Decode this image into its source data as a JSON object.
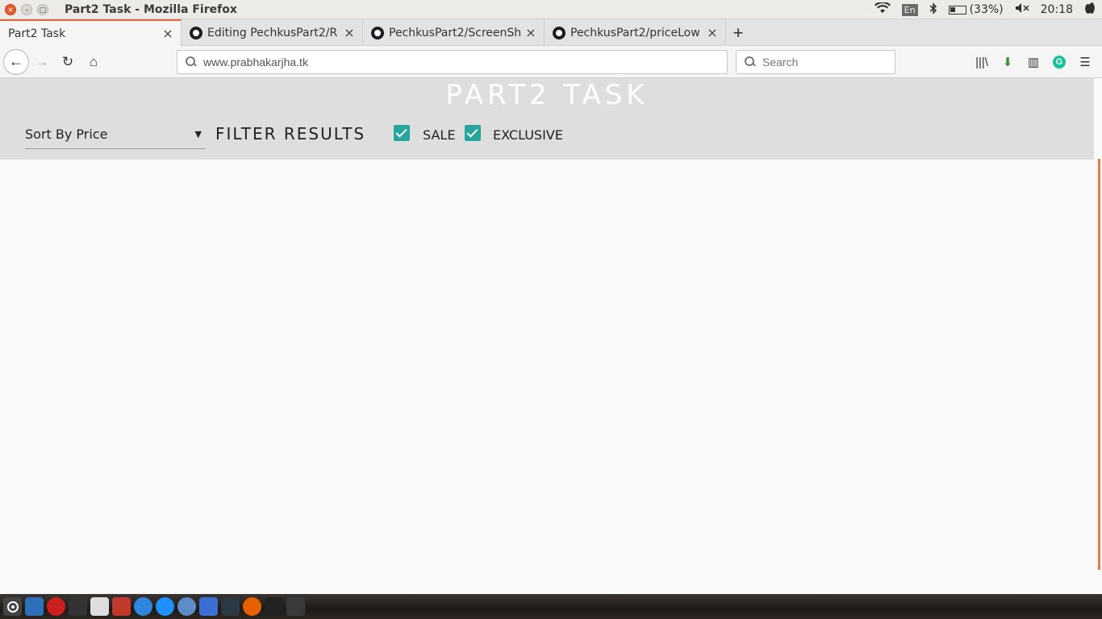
{
  "window": {
    "title": "Part2 Task - Mozilla Firefox",
    "close_glyph": "×",
    "minimize_glyph": "–",
    "maximize_glyph": "▢"
  },
  "system_tray": {
    "language": "En",
    "battery": "(33%)",
    "time": "20:18"
  },
  "tabs": [
    {
      "label": "Part2 Task",
      "active": true
    },
    {
      "label": "Editing PechkusPart2/R",
      "active": false
    },
    {
      "label": "PechkusPart2/ScreenSh",
      "active": false
    },
    {
      "label": "PechkusPart2/priceLow",
      "active": false
    }
  ],
  "tab_close_glyph": "×",
  "new_tab_glyph": "+",
  "navbar": {
    "url": "www.prabhakarjha.tk",
    "search_placeholder": "Search",
    "back_glyph": "←",
    "forward_glyph": "→",
    "reload_glyph": "↻",
    "home_glyph": "⌂"
  },
  "toolbar_icons": {
    "library": "|||\\",
    "download": "⬇",
    "sidebar": "▥",
    "grammarly": "G",
    "menu": "☰"
  },
  "page": {
    "site_title": "PART2 TASK",
    "sort_select_value": "Sort By Price",
    "filter_label": "FILTER RESULTS",
    "checkboxes": [
      {
        "label": "SALE",
        "checked": true
      },
      {
        "label": "EXCLUSIVE",
        "checked": true
      }
    ]
  },
  "colors": {
    "accent_checkbox": "#26a69a",
    "active_tab_accent": "#e06b3a",
    "header_band": "#dedede"
  },
  "dock_icons": [
    "ubuntu-icon",
    "files-icon",
    "opera-icon",
    "terminal-icon",
    "text-editor-icon",
    "video-icon",
    "app-store-icon",
    "browser-icon",
    "settings-icon",
    "office-icon",
    "monitor-icon",
    "firefox-icon",
    "console-icon",
    "tools-icon"
  ]
}
